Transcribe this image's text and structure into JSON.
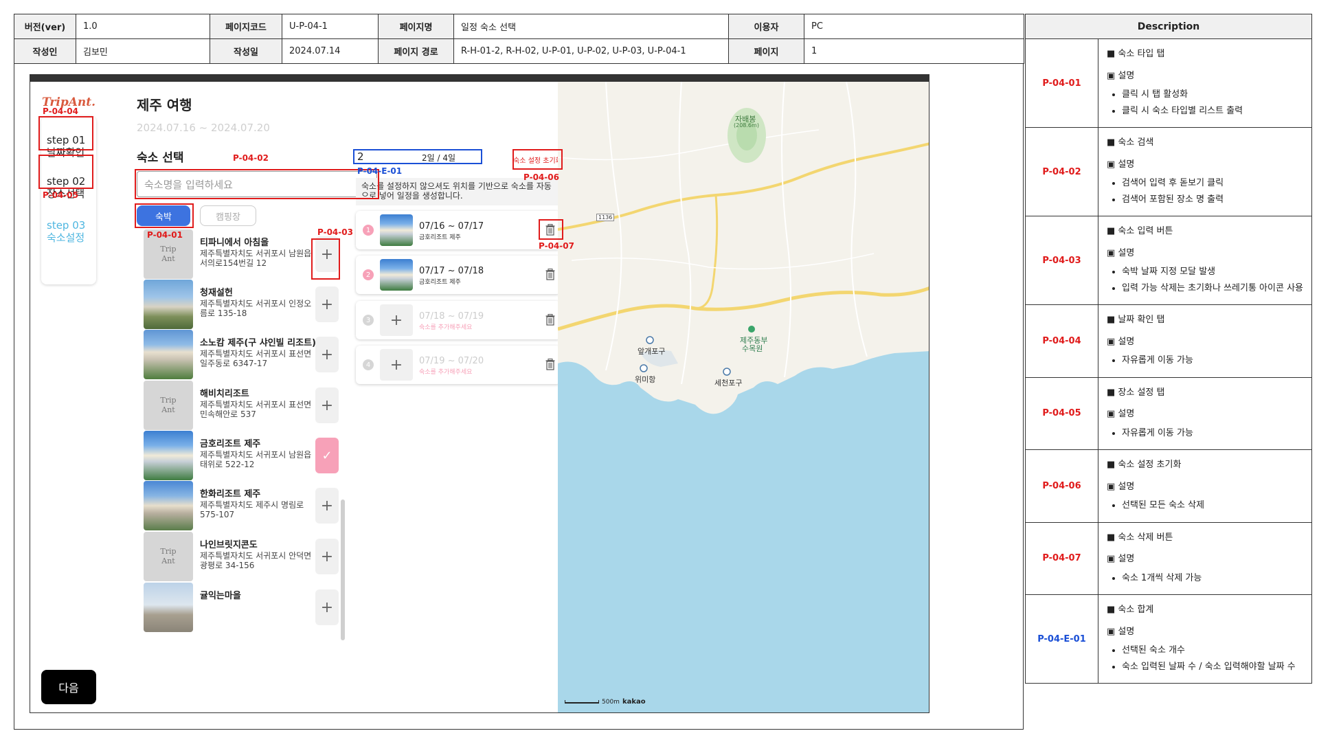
{
  "header": {
    "version_label": "버전(ver)",
    "version": "1.0",
    "page_code_label": "페이지코드",
    "page_code": "U-P-04-1",
    "page_name_label": "페이지명",
    "page_name": "일정 숙소 선택",
    "user_label": "이용자",
    "user": "PC",
    "author_label": "작성인",
    "author": "김보민",
    "date_label": "작성일",
    "date": "2024.07.14",
    "path_label": "페이지 경로",
    "path": "R-H-01-2, R-H-02, U-P-01, U-P-02, U-P-03, U-P-04-1",
    "page_label": "페이지",
    "page": "1"
  },
  "app": {
    "logo": "TripAnt.",
    "steps": [
      {
        "label": "step 01\n날짜확인"
      },
      {
        "label": "step 02\n장소선택"
      },
      {
        "label": "step 03\n숙소설정"
      }
    ],
    "next": "다음",
    "trip_title": "제주 여행",
    "trip_dates": "2024.07.16 ~ 2024.07.20",
    "section_title": "숙소 선택",
    "search_placeholder": "숙소명을 입력하세요",
    "tabs": {
      "lodge": "숙박",
      "camp": "캠핑장"
    },
    "placeholder_thumb": "Trip\nAnt",
    "list": [
      {
        "name": "티파니에서 아침을",
        "address": "제주특별자치도 서귀포시 남원읍 서의로154번길 12",
        "thumb": "placeholder",
        "state": "add"
      },
      {
        "name": "청재설헌",
        "address": "제주특별자치도 서귀포시 인정오름로 135-18",
        "thumb": "photo-a",
        "state": "add"
      },
      {
        "name": "소노캄 제주(구 샤인빌 리조트)",
        "address": "제주특별자치도 서귀포시 표선면 일주동로 6347-17",
        "thumb": "photo-b",
        "state": "add"
      },
      {
        "name": "해비치리조트",
        "address": "제주특별자치도 서귀포시 표선면 민속해안로 537",
        "thumb": "placeholder",
        "state": "add"
      },
      {
        "name": "금호리조트 제주",
        "address": "제주특별자치도 서귀포시 남원읍 태위로 522-12",
        "thumb": "photo-c",
        "state": "checked"
      },
      {
        "name": "한화리조트 제주",
        "address": "제주특별자치도 제주시 명림로 575-107",
        "thumb": "photo-d",
        "state": "add"
      },
      {
        "name": "나인브릿지콘도",
        "address": "제주특별자치도 서귀포시 안덕면 광평로 34-156",
        "thumb": "placeholder",
        "state": "add"
      },
      {
        "name": "귤익는마을",
        "address": "",
        "thumb": "photo-e",
        "state": "add"
      }
    ],
    "count": "2",
    "count_ratio": "2일 / 4일",
    "reset": "숙소 설정 초기화",
    "info": "숙소를 설정하지 않으셔도 위치를 기반으로 숙소를 자동으로 넣어 일정을 생성합니다.",
    "slots": [
      {
        "num": "1",
        "date": "07/16 ~ 07/17",
        "name": "금호리조트 제주",
        "filled": true
      },
      {
        "num": "2",
        "date": "07/17 ~ 07/18",
        "name": "금호리조트 제주",
        "filled": true
      },
      {
        "num": "3",
        "date": "07/18 ~ 07/19",
        "name": "숙소를 추가해주세요",
        "filled": false
      },
      {
        "num": "4",
        "date": "07/19 ~ 07/20",
        "name": "숙소를 추가해주세요",
        "filled": false
      }
    ],
    "map": {
      "labels": [
        "자배봉",
        "(208.6m)",
        "1136",
        "앞개포구",
        "위미항",
        "제주동부",
        "수목원",
        "세천포구"
      ],
      "scale": "500m",
      "brand": "kakao"
    }
  },
  "annotations": {
    "p0404": "P-04-04",
    "p0405": "P-04-05",
    "p0402": "P-04-02",
    "p0401": "P-04-01",
    "p0403": "P-04-03",
    "pe01": "P-04-E-01",
    "p0406": "P-04-06",
    "p0407": "P-04-07"
  },
  "description": {
    "title": "Description",
    "rows": [
      {
        "code": "P-04-01",
        "title": "숙소 타입 탭",
        "sub": "설명",
        "items": [
          "클릭 시 탭 활성화",
          "클릭 시 숙소 타입별 리스트 출력"
        ]
      },
      {
        "code": "P-04-02",
        "title": "숙소 검색",
        "sub": "설명",
        "items": [
          "검색어 입력 후 돋보기 클릭",
          "검색어 포함된 장소 명 출력"
        ]
      },
      {
        "code": "P-04-03",
        "title": "숙소 입력 버튼",
        "sub": "설명",
        "items": [
          "숙박 날짜 지정 모달 발생",
          "입력 가능 삭제는 초기화나 쓰레기통 아이콘 사용"
        ]
      },
      {
        "code": "P-04-04",
        "title": "날짜 확인 탭",
        "sub": "설명",
        "items": [
          "자유롭게 이동 가능"
        ]
      },
      {
        "code": "P-04-05",
        "title": "장소 설정 탭",
        "sub": "설명",
        "items": [
          "자유롭게 이동 가능"
        ]
      },
      {
        "code": "P-04-06",
        "title": "숙소 설정 초기화",
        "sub": "설명",
        "items": [
          "선택된 모든 숙소 삭제"
        ]
      },
      {
        "code": "P-04-07",
        "title": "숙소 삭제 버튼",
        "sub": "설명",
        "items": [
          "숙소 1개씩 삭제 가능"
        ]
      },
      {
        "code": "P-04-E-01",
        "title": "숙소 합계",
        "sub": "설명",
        "items": [
          "선택된 숙소 개수",
          "숙소 입력된 날짜 수 / 숙소 입력해야할 날짜 수"
        ]
      }
    ]
  },
  "colors": {
    "accent_blue": "#3d73e0",
    "annotation_red": "#e01b1b",
    "annotation_blue": "#1a4fd6",
    "pink": "#f7a1b8",
    "sea": "#a9d7ea",
    "road": "#f3d670"
  }
}
